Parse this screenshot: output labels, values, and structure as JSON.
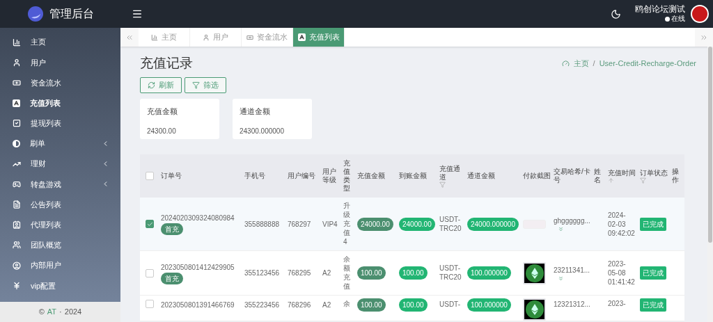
{
  "app": {
    "title": "管理后台"
  },
  "header": {
    "user_name": "鸥创论坛测试",
    "status": "在线"
  },
  "sidebar": {
    "items": [
      {
        "label": "主页",
        "selected": false,
        "expandable": false
      },
      {
        "label": "用户",
        "selected": false,
        "expandable": false
      },
      {
        "label": "资金流水",
        "selected": false,
        "expandable": false
      },
      {
        "label": "充值列表",
        "selected": true,
        "expandable": false
      },
      {
        "label": "提现列表",
        "selected": false,
        "expandable": false
      },
      {
        "label": "刷单",
        "selected": false,
        "expandable": true
      },
      {
        "label": "理财",
        "selected": false,
        "expandable": true
      },
      {
        "label": "转盘游戏",
        "selected": false,
        "expandable": true
      },
      {
        "label": "公告列表",
        "selected": false,
        "expandable": false
      },
      {
        "label": "代理列表",
        "selected": false,
        "expandable": false
      },
      {
        "label": "团队概览",
        "selected": false,
        "expandable": false
      },
      {
        "label": "内部用户",
        "selected": false,
        "expandable": false
      },
      {
        "label": "vip配置",
        "selected": false,
        "expandable": false
      }
    ],
    "footer": {
      "copyright": "©",
      "brand": "AT",
      "separator": "·",
      "year": "2024"
    }
  },
  "tabs": [
    {
      "label": "主页",
      "selected": false
    },
    {
      "label": "用户",
      "selected": false
    },
    {
      "label": "资金流水",
      "selected": false
    },
    {
      "label": "充值列表",
      "selected": true
    }
  ],
  "page": {
    "title": "充值记录",
    "breadcrumb": [
      "主页",
      "User-Credit-Recharge-Order"
    ],
    "separator": "/",
    "buttons": [
      "刷新",
      "筛选"
    ]
  },
  "stats": [
    {
      "label": "充值金额",
      "value": "24300.00"
    },
    {
      "label": "通道金额",
      "value": "24300.000000"
    }
  ],
  "table": {
    "header_checked": false,
    "columns": [
      {
        "label": "订单号",
        "filter": false,
        "sort": false
      },
      {
        "label": "手机号",
        "filter": false,
        "sort": false
      },
      {
        "label": "用户编号",
        "filter": false,
        "sort": false
      },
      {
        "label": "用户等级",
        "filter": false,
        "sort": false
      },
      {
        "label": "充值类型",
        "filter": false,
        "sort": false
      },
      {
        "label": "充值金额",
        "filter": false,
        "sort": false
      },
      {
        "label": "到账金额",
        "filter": false,
        "sort": false
      },
      {
        "label": "充值通道",
        "filter": true,
        "sort": false
      },
      {
        "label": "通道金额",
        "filter": false,
        "sort": false
      },
      {
        "label": "付款截图",
        "filter": false,
        "sort": false
      },
      {
        "label": "交易哈希/卡号",
        "filter": false,
        "sort": false
      },
      {
        "label": "姓名",
        "filter": false,
        "sort": false
      },
      {
        "label": "充值时间",
        "filter": false,
        "sort": true
      },
      {
        "label": "订单状态",
        "filter": true,
        "sort": false
      },
      {
        "label": "操作",
        "filter": false,
        "sort": false
      }
    ],
    "rows": [
      {
        "checked": true,
        "order_no": "2024020309324080984",
        "tag": "首充",
        "phone": "355888888",
        "user_id": "768297",
        "level": "VIP4",
        "type": "升级充值4",
        "amount": "24000.00",
        "received": "24000.00",
        "channel": "USDT-TRC20",
        "channel_amount": "24000.000000",
        "screenshot": {
          "kind": "banner"
        },
        "hash": "ghgggggg...",
        "date": "2024-02-03",
        "time": "09:42:02",
        "status": "已完成"
      },
      {
        "checked": false,
        "order_no": "2023050801412429905",
        "tag": "首充",
        "phone": "355123456",
        "user_id": "768295",
        "level": "A2",
        "type": "余额充值",
        "amount": "100.00",
        "received": "100.00",
        "channel": "USDT-TRC20",
        "channel_amount": "100.000000",
        "screenshot": {
          "kind": "coin"
        },
        "hash": "23211341...",
        "date": "2023-05-08",
        "time": "01:41:42",
        "status": "已完成"
      },
      {
        "checked": false,
        "order_no": "2023050801391466769",
        "phone": "355223456",
        "user_id": "768296",
        "level": "A2",
        "type": "余",
        "amount": "100.00",
        "received": "100.00",
        "channel": "USDT-",
        "channel_amount": "100.000000",
        "screenshot": {
          "kind": "coin"
        },
        "hash": "12321312...",
        "date": "2023-",
        "status": "已完成"
      }
    ]
  }
}
